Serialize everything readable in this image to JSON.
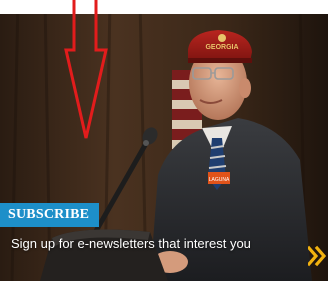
{
  "subscribe": {
    "label": "SUBSCRIBE"
  },
  "tagline": "Sign up for e-newsletters that interest you",
  "cap_text": "GEORGIA",
  "badge_text": "LAGUNA",
  "colors": {
    "accent_blue": "#1d8fc9",
    "arrow_red": "#e21c1c",
    "chevron_gold": "#f2b20f"
  },
  "icons": {
    "annotation_arrow": "down-arrow-outline-icon",
    "next": "double-chevron-right-icon"
  }
}
